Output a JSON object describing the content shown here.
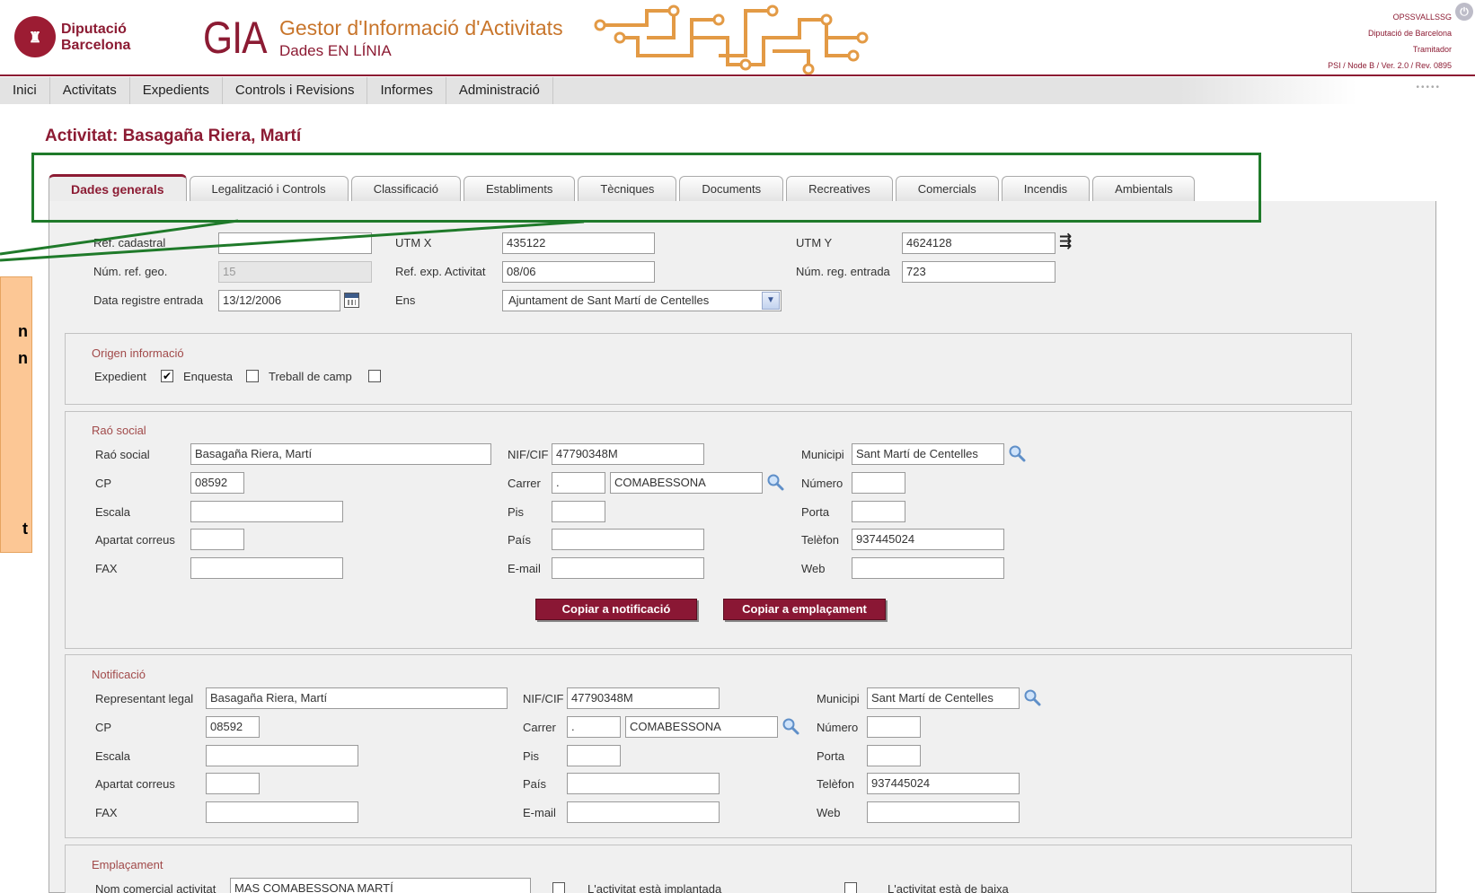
{
  "header": {
    "org_line1": "Diputació",
    "org_line2": "Barcelona",
    "app_short": "GIA",
    "app_title": "Gestor d'Informació d'Activitats",
    "app_subtitle": "Dades EN LÍNIA",
    "user_name": "OPSSVALLSSG",
    "user_org": "Diputació de Barcelona",
    "user_role": "Tramitador",
    "version": "PSI / Node B / Ver. 2.0 / Rev. 0895",
    "brand_color": "#8c1b33",
    "accent_color": "#c8752b"
  },
  "menu": {
    "items": [
      "Inici",
      "Activitats",
      "Expedients",
      "Controls i Revisions",
      "Informes",
      "Administració"
    ],
    "dots": "•••••"
  },
  "page": {
    "title": "Activitat: Basagaña Riera, Martí"
  },
  "tabs": [
    {
      "label": "Dades generals",
      "active": true
    },
    {
      "label": "Legalització i Controls",
      "active": false
    },
    {
      "label": "Classificació",
      "active": false
    },
    {
      "label": "Establiments",
      "active": false
    },
    {
      "label": "Tècniques",
      "active": false
    },
    {
      "label": "Documents",
      "active": false
    },
    {
      "label": "Recreatives",
      "active": false
    },
    {
      "label": "Comercials",
      "active": false
    },
    {
      "label": "Incendis",
      "active": false
    },
    {
      "label": "Ambientals",
      "active": false
    }
  ],
  "callout": {
    "letters": [
      "n",
      "n",
      "t"
    ]
  },
  "general": {
    "ref_cadastral_label": "Ref. cadastral",
    "ref_cadastral": "",
    "utm_x_label": "UTM X",
    "utm_x": "435122",
    "utm_y_label": "UTM Y",
    "utm_y": "4624128",
    "num_ref_geo_label": "Núm. ref. geo.",
    "num_ref_geo": "15",
    "ref_exp_label": "Ref. exp. Activitat",
    "ref_exp": "08/06",
    "num_reg_label": "Núm. reg. entrada",
    "num_reg": "723",
    "data_reg_label": "Data registre entrada",
    "data_reg": "13/12/2006",
    "ens_label": "Ens",
    "ens": "Ajuntament de Sant Martí de Centelles"
  },
  "origen": {
    "legend": "Origen informació",
    "expedient_label": "Expedient",
    "expedient_checked": true,
    "enquesta_label": "Enquesta",
    "enquesta_checked": false,
    "treball_label": "Treball de camp",
    "treball_checked": false,
    "check_glyph": "✔"
  },
  "rao_social": {
    "legend": "Raó social",
    "rao_label": "Raó social",
    "rao": "Basagaña Riera, Martí",
    "nif_label": "NIF/CIF",
    "nif": "47790348M",
    "municipi_label": "Municipi",
    "municipi": "Sant Martí de Centelles",
    "cp_label": "CP",
    "cp": "08592",
    "carrer_label": "Carrer",
    "carrer_tipus": ".",
    "carrer": "COMABESSONA",
    "numero_label": "Número",
    "numero": "",
    "escala_label": "Escala",
    "escala": "",
    "pis_label": "Pis",
    "pis": "",
    "porta_label": "Porta",
    "porta": "",
    "apartat_label": "Apartat correus",
    "apartat": "",
    "pais_label": "País",
    "pais": "",
    "telefon_label": "Telèfon",
    "telefon": "937445024",
    "fax_label": "FAX",
    "fax": "",
    "email_label": "E-mail",
    "email": "",
    "web_label": "Web",
    "web": "",
    "btn_copy_notif": "Copiar a notificació",
    "btn_copy_empl": "Copiar a emplaçament"
  },
  "notificacio": {
    "legend": "Notificació",
    "rep_label": "Representant legal",
    "rep": "Basagaña Riera, Martí",
    "nif_label": "NIF/CIF",
    "nif": "47790348M",
    "municipi_label": "Municipi",
    "municipi": "Sant Martí de Centelles",
    "cp_label": "CP",
    "cp": "08592",
    "carrer_label": "Carrer",
    "carrer_tipus": ".",
    "carrer": "COMABESSONA",
    "numero_label": "Número",
    "numero": "",
    "escala_label": "Escala",
    "escala": "",
    "pis_label": "Pis",
    "pis": "",
    "porta_label": "Porta",
    "porta": "",
    "apartat_label": "Apartat correus",
    "apartat": "",
    "pais_label": "País",
    "pais": "",
    "telefon_label": "Telèfon",
    "telefon": "937445024",
    "fax_label": "FAX",
    "fax": "",
    "email_label": "E-mail",
    "email": "",
    "web_label": "Web",
    "web": ""
  },
  "emplacament": {
    "legend": "Emplaçament",
    "nom_label": "Nom comercial activitat",
    "nom": "MAS COMABESSONA MARTÍ",
    "implantada_label": "L'activitat està implantada",
    "baixa_label": "L'activitat està de baixa"
  }
}
